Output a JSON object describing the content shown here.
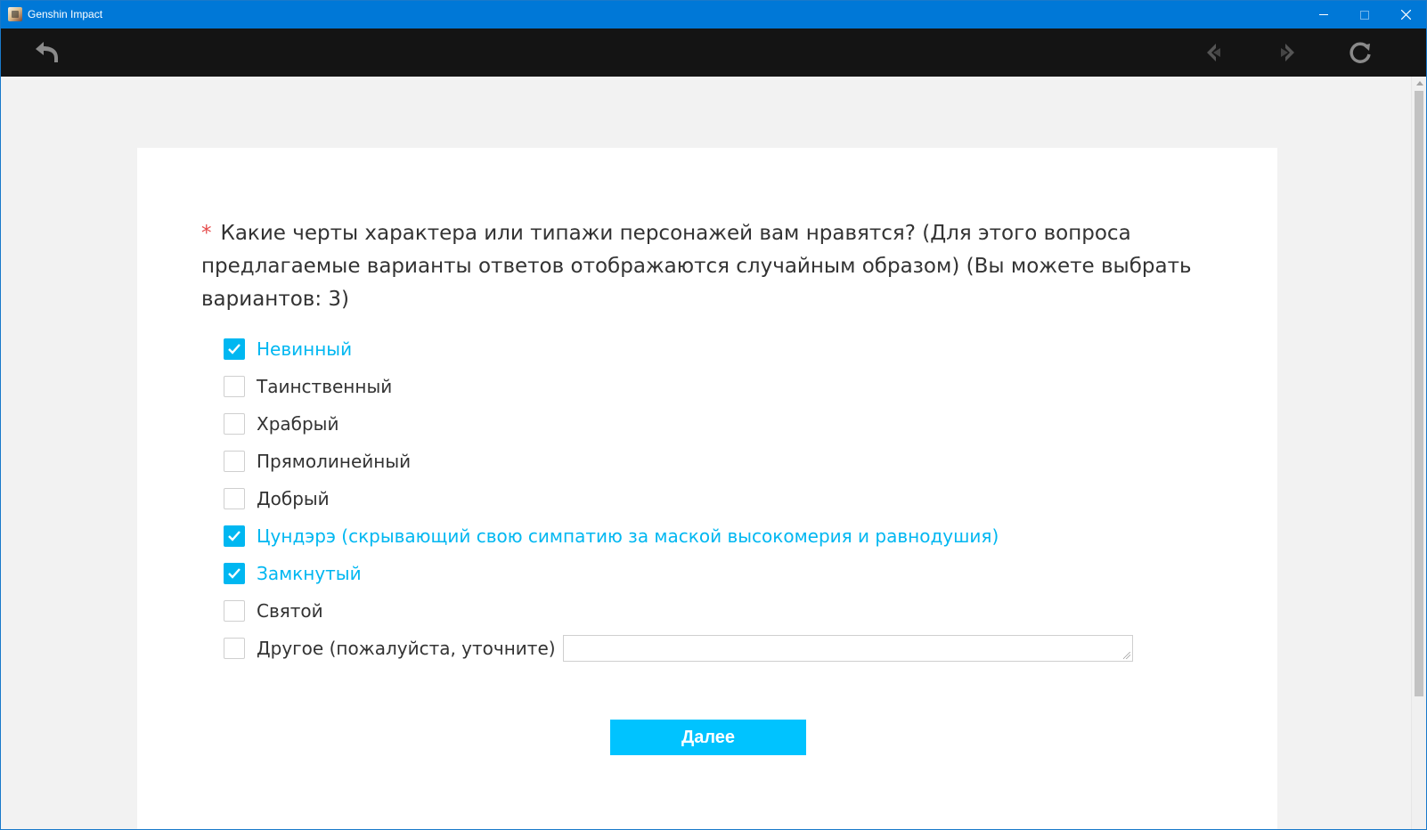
{
  "window": {
    "title": "Genshin Impact",
    "accent": "#0078d7"
  },
  "toolbar": {
    "back_icon": "undo-arrow-icon",
    "prev_icon": "chevron-left-icon",
    "next_icon": "chevron-right-icon",
    "reload_icon": "reload-icon"
  },
  "survey": {
    "required_marker": "*",
    "question": "Какие черты характера или типажи персонажей вам нравятся? (Для этого вопроса предлагаемые варианты ответов отображаются случайным образом)  (Вы можете выбрать вариантов: 3)",
    "options": [
      {
        "label": "Невинный",
        "checked": true
      },
      {
        "label": "Таинственный",
        "checked": false
      },
      {
        "label": "Храбрый",
        "checked": false
      },
      {
        "label": "Прямолинейный",
        "checked": false
      },
      {
        "label": "Добрый",
        "checked": false
      },
      {
        "label": "Цундэрэ (скрывающий свою симпатию за маской высокомерия и равнодушия)",
        "checked": true
      },
      {
        "label": "Замкнутый",
        "checked": true
      },
      {
        "label": "Святой",
        "checked": false
      },
      {
        "label": "Другое (пожалуйста, уточните)",
        "checked": false
      }
    ],
    "other_value": "",
    "next_label": "Далее",
    "accent": "#00b7f1"
  }
}
